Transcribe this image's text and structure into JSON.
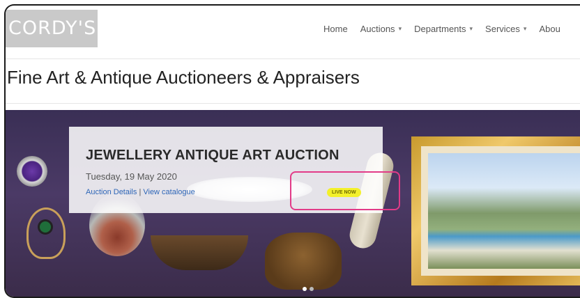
{
  "header": {
    "logo_text": "CORDY'S",
    "nav": [
      {
        "label": "Home",
        "has_dropdown": false
      },
      {
        "label": "Auctions",
        "has_dropdown": true
      },
      {
        "label": "Departments",
        "has_dropdown": true
      },
      {
        "label": "Services",
        "has_dropdown": true
      },
      {
        "label": "Abou",
        "has_dropdown": false
      }
    ]
  },
  "page": {
    "title": "Fine Art & Antique Auctioneers & Appraisers"
  },
  "hero": {
    "auction_title": "JEWELLERY ANTIQUE ART AUCTION",
    "date": "Tuesday, 19 May 2020",
    "link_details": "Auction Details",
    "separator": "|",
    "link_catalogue": "View catalogue",
    "badge": "LIVE NOW",
    "badge_color": "#f3f02a",
    "highlight_color": "#e23b88",
    "carousel": {
      "total": 2,
      "active": 1
    }
  }
}
